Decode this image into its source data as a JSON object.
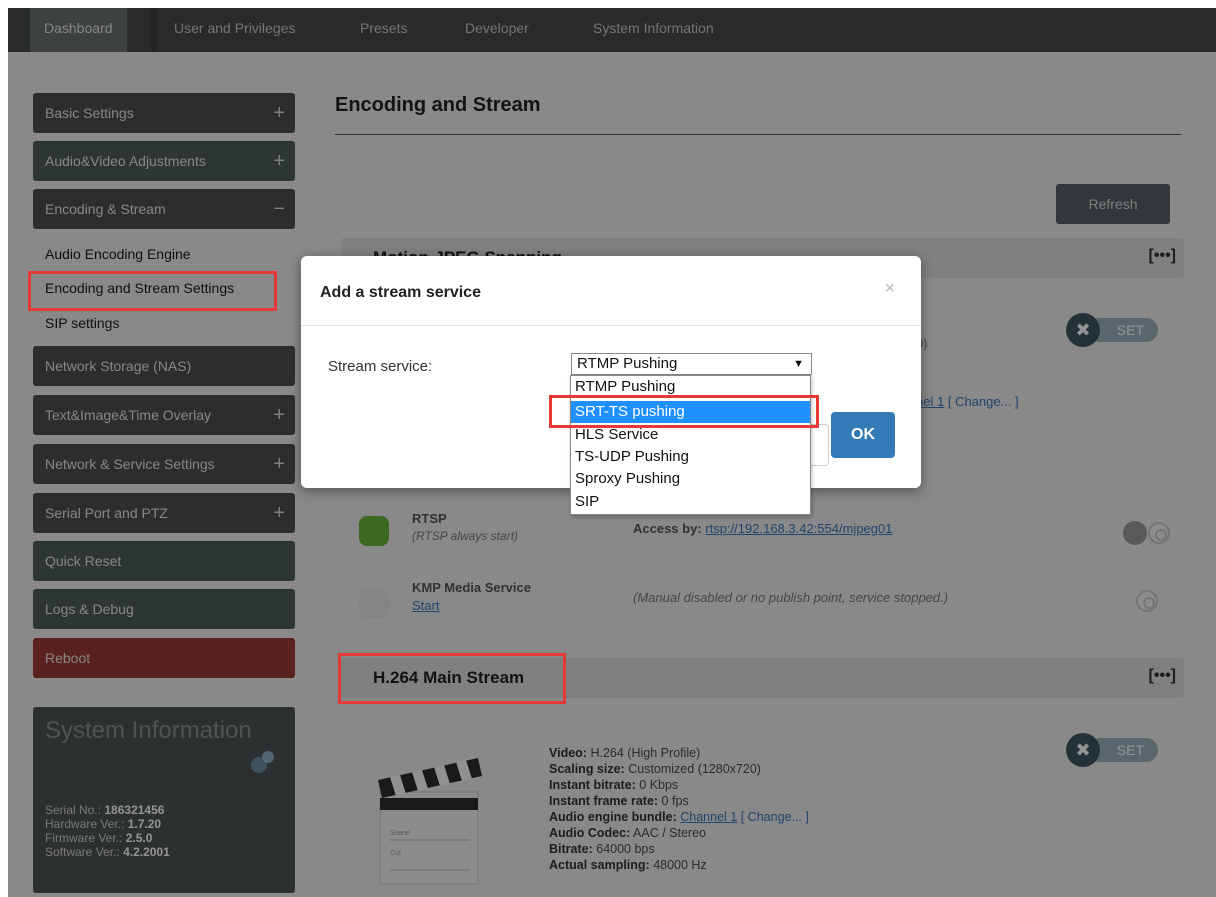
{
  "topnav": {
    "tabs": [
      "Dashboard",
      "User and Privileges",
      "Presets",
      "Developer",
      "System Information"
    ]
  },
  "sidebar": {
    "groups": [
      {
        "label": "Basic Settings",
        "toggle": "+"
      },
      {
        "label": "Audio&Video Adjustments",
        "toggle": "+"
      },
      {
        "label": "Encoding & Stream",
        "toggle": "−"
      }
    ],
    "links": [
      "Audio Encoding Engine",
      "Encoding and Stream Settings",
      "SIP settings"
    ],
    "groups2": [
      {
        "label": "Network Storage (NAS)",
        "toggle": ""
      },
      {
        "label": "Text&Image&Time Overlay",
        "toggle": "+"
      },
      {
        "label": "Network & Service Settings",
        "toggle": "+"
      },
      {
        "label": "Serial Port and PTZ",
        "toggle": "+"
      },
      {
        "label": "Quick Reset",
        "toggle": ""
      },
      {
        "label": "Logs & Debug",
        "toggle": ""
      },
      {
        "label": "Reboot",
        "toggle": ""
      }
    ]
  },
  "sysinfo": {
    "title": "System Information",
    "serial_label": "Serial No.:",
    "serial": "186321456",
    "hardware_label": "Hardware Ver.:",
    "hardware": "1.7.20",
    "firmware_label": "Firmware Ver.:",
    "firmware": "2.5.0",
    "software_label": "Software Ver.:",
    "software": "4.2.2001"
  },
  "main": {
    "title": "Encoding and Stream",
    "refresh_label": "Refresh",
    "section1": "Motion-JPEG Snapping",
    "section2": "H.264 Main Stream",
    "dots": "[•••]",
    "set_label": "SET",
    "set_suffix": "0)",
    "channel_tail": "nel 1",
    "change_label": "[ Change... ]",
    "rtsp": {
      "title": "RTSP",
      "sub": "(RTSP always start)",
      "access_label": "Access by:",
      "access_url": "rtsp://192.168.3.42:554/mjpeg01"
    },
    "kmp": {
      "title": "KMP Media Service",
      "start": "Start",
      "note": "(Manual disabled or no publish point, service stopped.)"
    },
    "h264": {
      "video_label": "Video:",
      "video": "H.264 (High Profile)",
      "scaling_label": "Scaling size:",
      "scaling": "Customized (1280x720)",
      "bitrate_label": "Instant bitrate:",
      "bitrate": "0 Kbps",
      "framerate_label": "Instant frame rate:",
      "framerate": "0 fps",
      "bundle_label": "Audio engine bundle:",
      "bundle": "Channel 1",
      "bundle_change": "[ Change... ]",
      "codec_label": "Audio Codec:",
      "codec": "AAC / Stereo",
      "abitrate_label": "Bitrate:",
      "abitrate": "64000 bps",
      "sampling_label": "Actual sampling:",
      "sampling": "48000 Hz",
      "clapper_scene": "Scene",
      "clapper_cut": "Cut"
    }
  },
  "modal": {
    "title": "Add a stream service",
    "close": "×",
    "field_label": "Stream service:",
    "selected": "RTMP Pushing",
    "arrow": "▼",
    "options": [
      "RTMP Pushing",
      "SRT-TS pushing",
      "HLS Service",
      "TS-UDP Pushing",
      "Sproxy Pushing",
      "SIP"
    ],
    "highlighted_index": 1,
    "ok_label": "OK"
  },
  "colors": {
    "highlight": "#1e90ff",
    "annotation_red": "#e53935",
    "ok_blue": "#337ab7"
  }
}
